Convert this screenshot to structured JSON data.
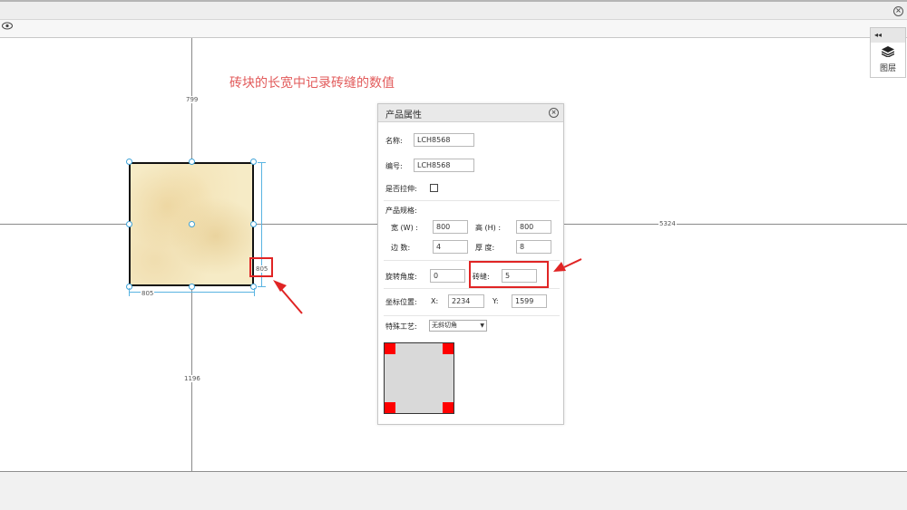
{
  "app": {
    "close_symbol": "×",
    "view_icon": "eye-icon"
  },
  "canvas": {
    "dimensions": {
      "top": "799",
      "bottom": "1196",
      "right": "5324",
      "tile_width": "805",
      "tile_height": "805"
    },
    "annotation": "砖块的长宽中记录砖缝的数值"
  },
  "layers": {
    "collapse_symbol": "◂◂",
    "label": "图层",
    "icon": "layers-icon"
  },
  "panel": {
    "title": "产品属性",
    "close_symbol": "×",
    "name_label": "名称:",
    "name_value": "LCH8568",
    "code_label": "编号:",
    "code_value": "LCH8568",
    "stretch_label": "是否拉伸:",
    "spec_label": "产品规格:",
    "width_label": "宽 (W) :",
    "width_value": "800",
    "height_label": "高 (H) :",
    "height_value": "800",
    "edges_label": "边   数:",
    "edges_value": "4",
    "thickness_label": "厚   度:",
    "thickness_value": "8",
    "rotation_label": "旋转角度:",
    "rotation_value": "0",
    "joint_label": "砖缝:",
    "joint_value": "5",
    "position_label": "坐标位置:",
    "x_label": "X:",
    "x_value": "2234",
    "y_label": "Y:",
    "y_value": "1599",
    "craft_label": "特殊工艺:",
    "craft_value": "无斜切角",
    "craft_arrow": "▼"
  },
  "colors": {
    "accent_red": "#e02424",
    "corner_red": "#ff0000",
    "handle_blue": "#3fa3d8"
  }
}
